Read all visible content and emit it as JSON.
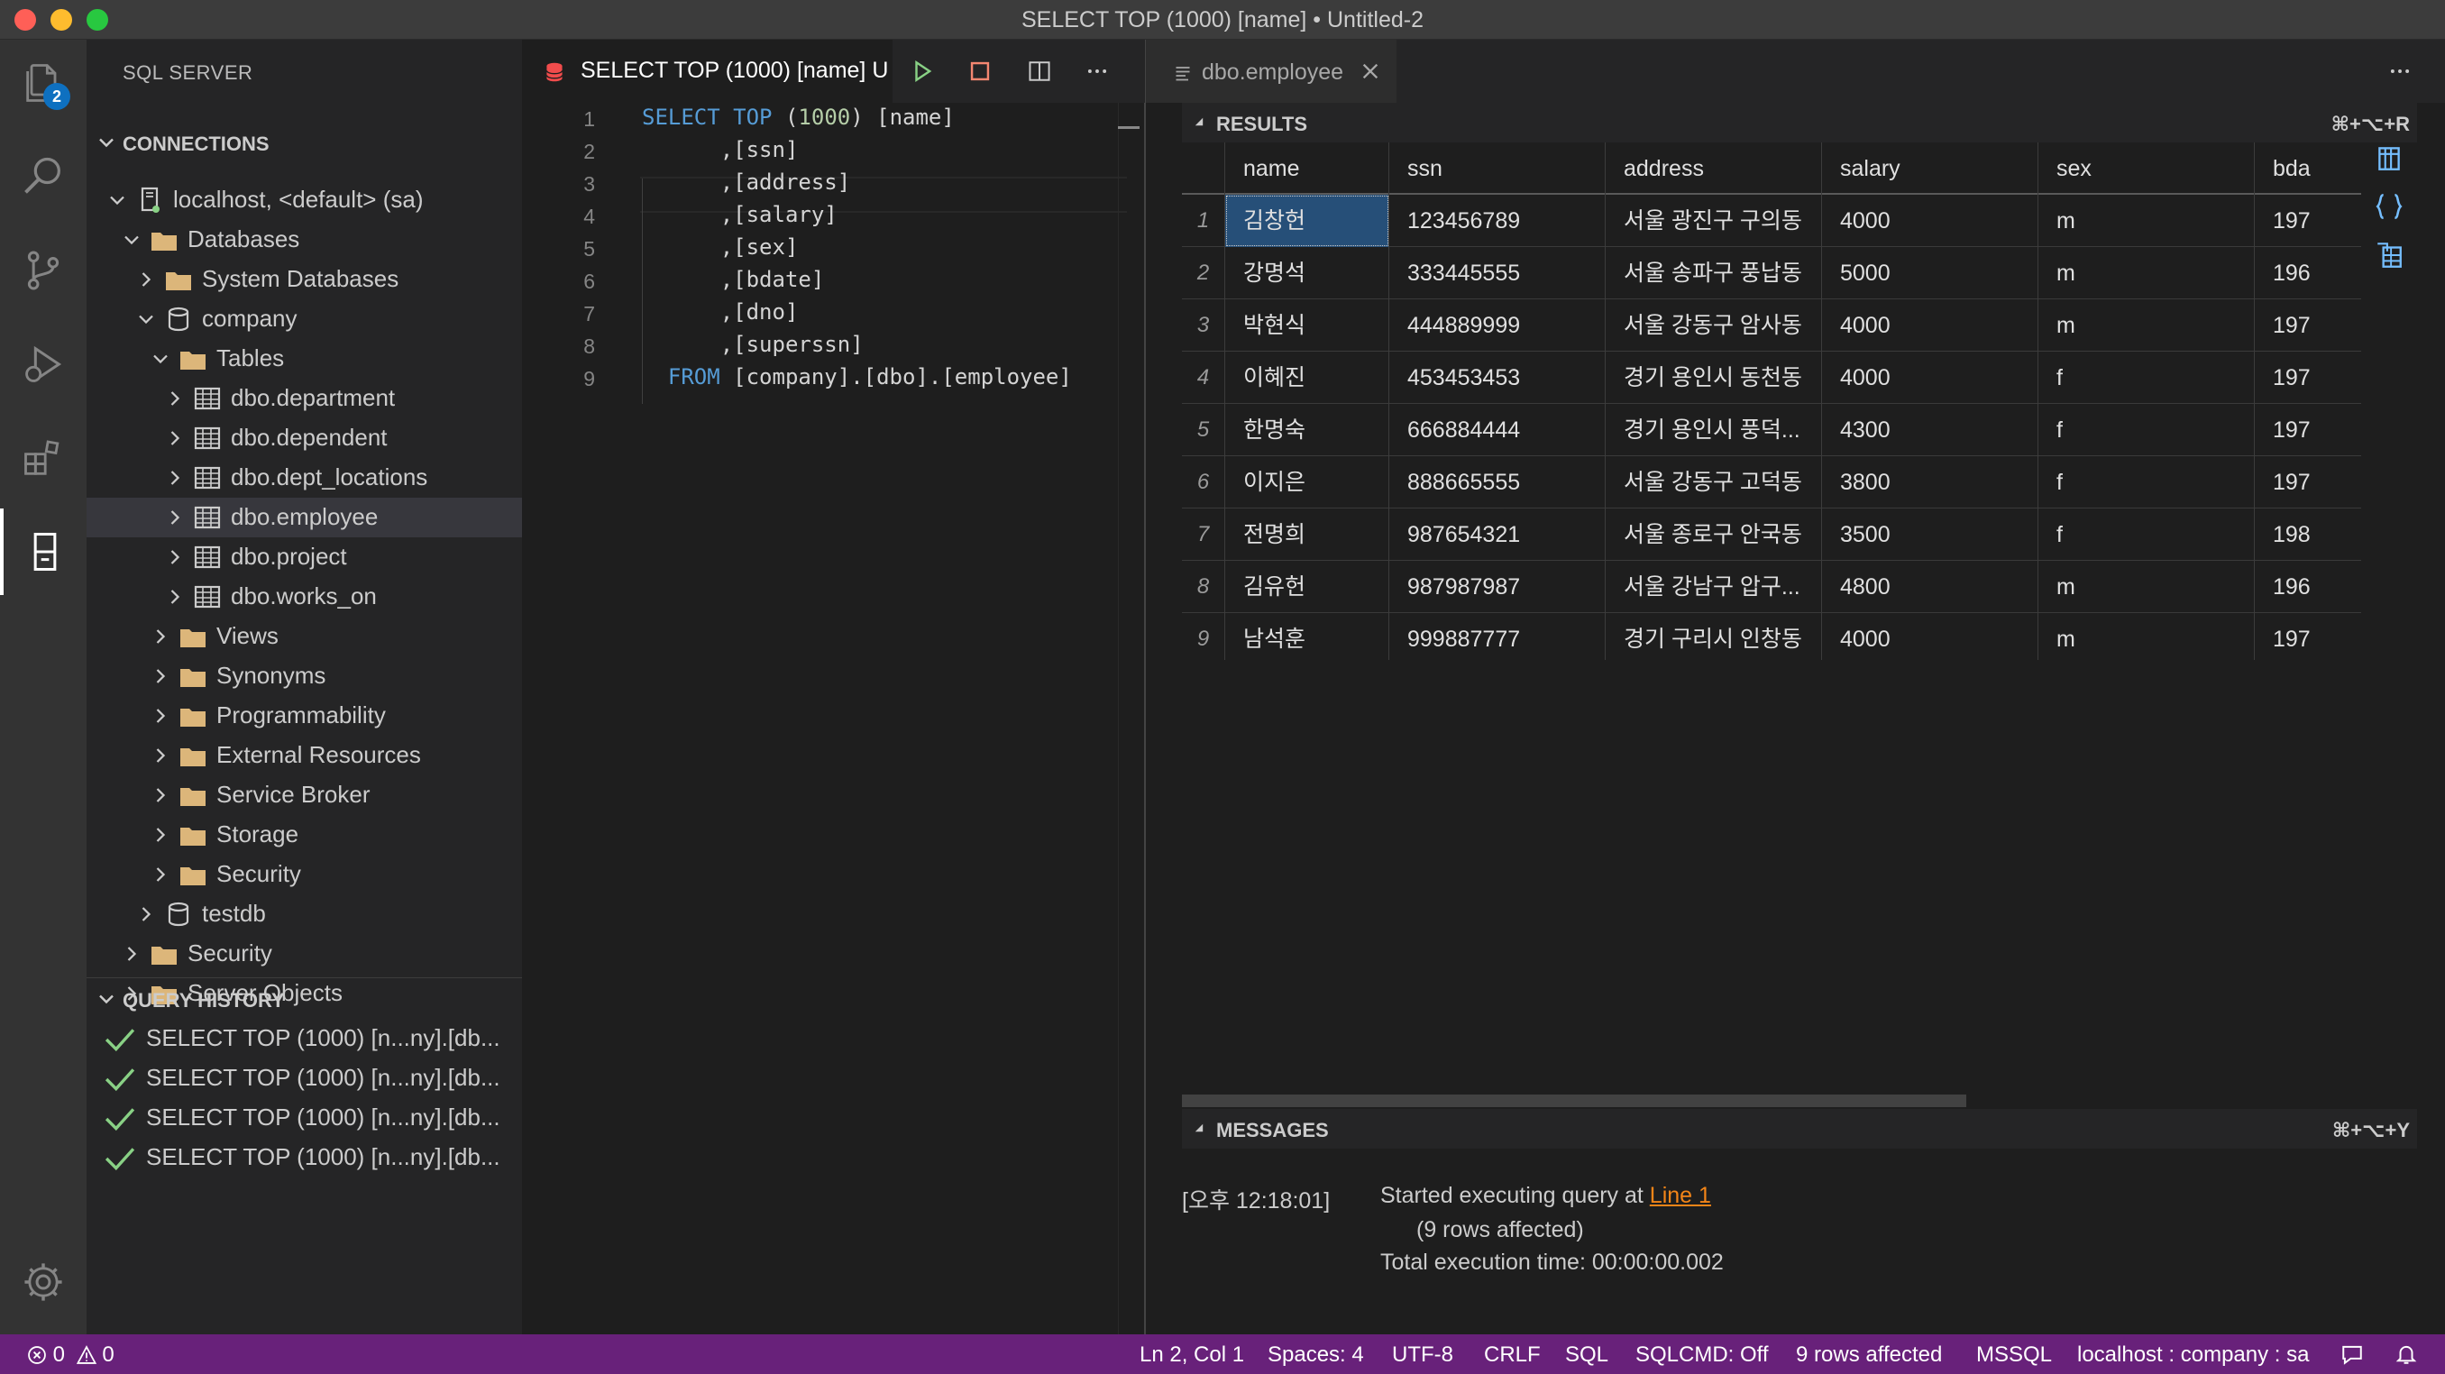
{
  "window": {
    "title": "SELECT TOP (1000) [name] • Untitled-2"
  },
  "activity_bar": {
    "explorer_badge": "2",
    "items": [
      "explorer-icon",
      "search-icon",
      "source-control-icon",
      "run-debug-icon",
      "extensions-icon",
      "connections-icon",
      "settings-gear-icon"
    ]
  },
  "sidebar": {
    "title": "SQL SERVER",
    "connections_header": "CONNECTIONS",
    "tree": [
      {
        "label": "localhost, <default> (sa)",
        "icon": "server-icon",
        "expanded": true
      },
      {
        "label": "Databases",
        "icon": "folder-icon",
        "expanded": true
      },
      {
        "label": "System Databases",
        "icon": "folder-icon",
        "expanded": false
      },
      {
        "label": "company",
        "icon": "database-icon",
        "expanded": true
      },
      {
        "label": "Tables",
        "icon": "folder-icon",
        "expanded": true
      },
      {
        "label": "dbo.department",
        "icon": "table-icon",
        "expanded": false
      },
      {
        "label": "dbo.dependent",
        "icon": "table-icon",
        "expanded": false
      },
      {
        "label": "dbo.dept_locations",
        "icon": "table-icon",
        "expanded": false
      },
      {
        "label": "dbo.employee",
        "icon": "table-icon",
        "expanded": false,
        "selected": true
      },
      {
        "label": "dbo.project",
        "icon": "table-icon",
        "expanded": false
      },
      {
        "label": "dbo.works_on",
        "icon": "table-icon",
        "expanded": false
      },
      {
        "label": "Views",
        "icon": "folder-icon",
        "expanded": false
      },
      {
        "label": "Synonyms",
        "icon": "folder-icon",
        "expanded": false
      },
      {
        "label": "Programmability",
        "icon": "folder-icon",
        "expanded": false
      },
      {
        "label": "External Resources",
        "icon": "folder-icon",
        "expanded": false
      },
      {
        "label": "Service Broker",
        "icon": "folder-icon",
        "expanded": false
      },
      {
        "label": "Storage",
        "icon": "folder-icon",
        "expanded": false
      },
      {
        "label": "Security",
        "icon": "folder-icon",
        "expanded": false
      },
      {
        "label": "testdb",
        "icon": "database-icon",
        "expanded": false
      },
      {
        "label": "Security",
        "icon": "folder-icon",
        "expanded": false
      },
      {
        "label": "Server Objects",
        "icon": "folder-icon",
        "expanded": false
      }
    ],
    "history_header": "QUERY HISTORY",
    "history": [
      "SELECT TOP (1000) [n...ny].[db...",
      "SELECT TOP (1000) [n...ny].[db...",
      "SELECT TOP (1000) [n...ny].[db...",
      "SELECT TOP (1000) [n...ny].[db..."
    ]
  },
  "editor": {
    "tab_label": "SELECT TOP (1000) [name] U",
    "line_numbers": [
      "1",
      "2",
      "3",
      "4",
      "5",
      "6",
      "7",
      "8",
      "9"
    ],
    "lines": [
      [
        {
          "t": "SELECT",
          "c": "kw"
        },
        {
          "t": " ",
          "c": ""
        },
        {
          "t": "TOP",
          "c": "kw"
        },
        {
          "t": " (",
          "c": ""
        },
        {
          "t": "1000",
          "c": "num"
        },
        {
          "t": ") [name]",
          "c": ""
        }
      ],
      [
        {
          "t": "      ,[ssn]",
          "c": ""
        }
      ],
      [
        {
          "t": "      ,[address]",
          "c": ""
        }
      ],
      [
        {
          "t": "      ,[salary]",
          "c": ""
        }
      ],
      [
        {
          "t": "      ,[sex]",
          "c": ""
        }
      ],
      [
        {
          "t": "      ,[bdate]",
          "c": ""
        }
      ],
      [
        {
          "t": "      ,[dno]",
          "c": ""
        }
      ],
      [
        {
          "t": "      ,[superssn]",
          "c": ""
        }
      ],
      [
        {
          "t": "  ",
          "c": ""
        },
        {
          "t": "FROM",
          "c": "kw"
        },
        {
          "t": " [company].[dbo].[employee]",
          "c": ""
        }
      ]
    ]
  },
  "results_view": {
    "tab_label": "dbo.employee",
    "results_header": "RESULTS",
    "results_shortcut": "⌘+⌥+R",
    "columns": [
      "name",
      "ssn",
      "address",
      "salary",
      "sex",
      "bda"
    ],
    "rows": [
      [
        "1",
        "김창헌",
        "123456789",
        "서울 광진구 구의동",
        "4000",
        "m",
        "197"
      ],
      [
        "2",
        "강명석",
        "333445555",
        "서울 송파구 풍납동",
        "5000",
        "m",
        "196"
      ],
      [
        "3",
        "박현식",
        "444889999",
        "서울 강동구 암사동",
        "4000",
        "m",
        "197"
      ],
      [
        "4",
        "이혜진",
        "453453453",
        "경기 용인시 동천동",
        "4000",
        "f",
        "197"
      ],
      [
        "5",
        "한명숙",
        "666884444",
        "경기 용인시 풍덕...",
        "4300",
        "f",
        "197"
      ],
      [
        "6",
        "이지은",
        "888665555",
        "서울 강동구 고덕동",
        "3800",
        "f",
        "197"
      ],
      [
        "7",
        "전명희",
        "987654321",
        "서울 종로구 안국동",
        "3500",
        "f",
        "198"
      ],
      [
        "8",
        "김유헌",
        "987987987",
        "서울 강남구 압구...",
        "4800",
        "m",
        "196"
      ],
      [
        "9",
        "남석훈",
        "999887777",
        "경기 구리시 인창동",
        "4000",
        "m",
        "197"
      ]
    ],
    "messages_header": "MESSAGES",
    "messages_shortcut": "⌘+⌥+Y",
    "message_timestamp": "[오후 12:18:01]",
    "message_start": "Started executing query at ",
    "message_link": "Line 1",
    "message_rows": "(9 rows affected)",
    "message_time": "Total execution time: 00:00:00.002"
  },
  "status_bar": {
    "errors": "0",
    "warnings": "0",
    "position": "Ln 2, Col 1",
    "spaces": "Spaces: 4",
    "encoding": "UTF-8",
    "eol": "CRLF",
    "language": "SQL",
    "sqlcmd": "SQLCMD: Off",
    "rows_affected": "9 rows affected",
    "provider": "MSSQL",
    "connection": "localhost : company : sa"
  },
  "colors": {
    "status_bar": "#68217a",
    "accent_blue": "#569cd6",
    "selection": "#264f78",
    "run_green": "#89d185",
    "stop_red": "#f48771",
    "link_orange": "#f38518"
  }
}
